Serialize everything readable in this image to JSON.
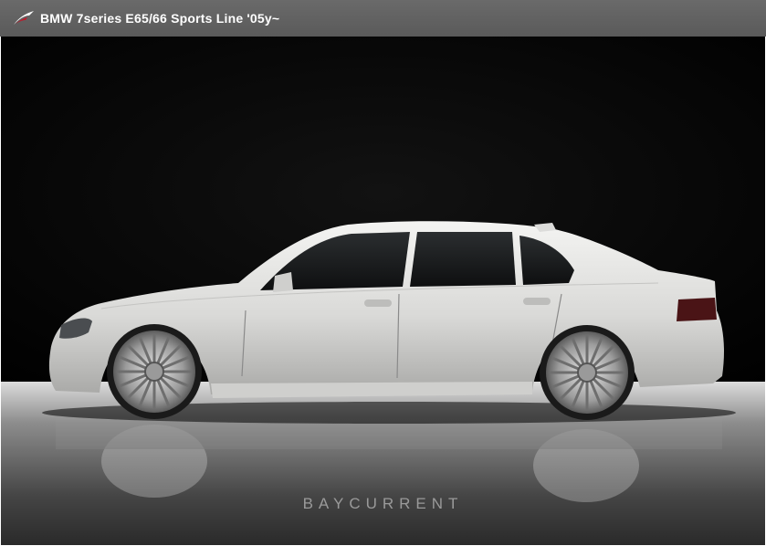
{
  "header": {
    "title": "BMW 7series E65/66 Sports Line '05y~",
    "logo_icon": "swoosh-logo-icon",
    "background_color": "#5f5f5f"
  },
  "photo": {
    "watermark": "BAYCURRENT",
    "car_color": "#e6e6e4",
    "backdrop_color": "#000000"
  }
}
